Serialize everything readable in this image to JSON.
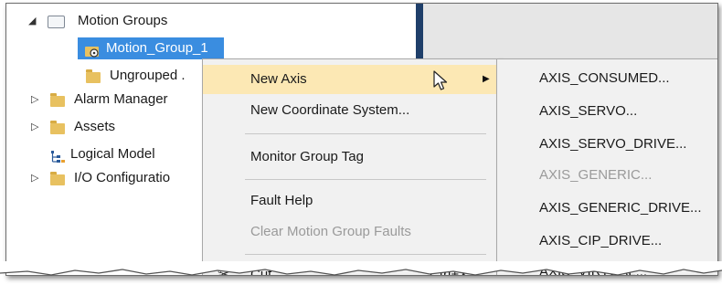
{
  "tree": {
    "items": [
      {
        "label": "Motion Groups"
      },
      {
        "label": "Motion_Group_1"
      },
      {
        "label": "Ungrouped ."
      },
      {
        "label": "Alarm Manager"
      },
      {
        "label": "Assets"
      },
      {
        "label": "Logical Model"
      },
      {
        "label": "I/O Configuratio"
      }
    ]
  },
  "context_menu": {
    "items": [
      {
        "label": "New Axis",
        "state": "hovered",
        "has_submenu": true
      },
      {
        "label": "New Coordinate System..."
      },
      {
        "label": "Monitor Group Tag"
      },
      {
        "label": "Fault Help"
      },
      {
        "label": "Clear Motion Group Faults",
        "state": "disabled"
      },
      {
        "label": "Cut",
        "shortcut": "Ctrl+X"
      }
    ]
  },
  "submenu": {
    "items": [
      {
        "label": "AXIS_CONSUMED..."
      },
      {
        "label": "AXIS_SERVO..."
      },
      {
        "label": "AXIS_SERVO_DRIVE..."
      },
      {
        "label": "AXIS_GENERIC...",
        "state": "disabled"
      },
      {
        "label": "AXIS_GENERIC_DRIVE..."
      },
      {
        "label": "AXIS_CIP_DRIVE..."
      },
      {
        "label": "AXIS_VIRTUAL..."
      }
    ]
  },
  "colors": {
    "selection": "#3a8de0",
    "menu_hover": "#fce8b4",
    "splitter": "#1f3f6a",
    "disabled_text": "#9a9a9a"
  },
  "icons": [
    "expanded-arrow-icon",
    "collapsed-arrow-icon",
    "folder-icon",
    "motion-group-gear-icon",
    "logical-model-icon",
    "scissors-icon",
    "submenu-arrow-icon",
    "mouse-cursor-icon"
  ]
}
